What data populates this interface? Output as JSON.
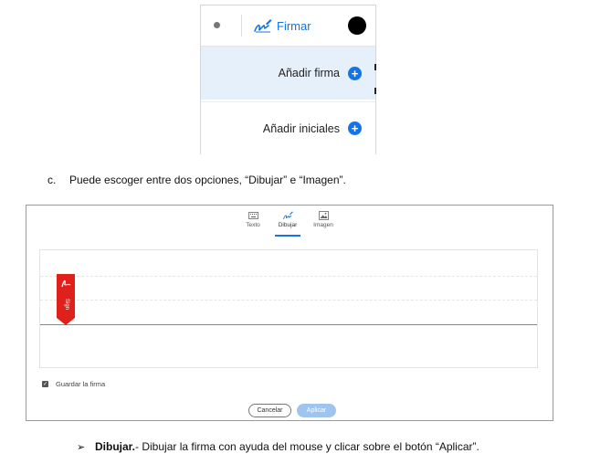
{
  "menu": {
    "firmar_label": "Firmar",
    "items": [
      {
        "label": "Añadir firma",
        "icon": "plus-circle-icon"
      },
      {
        "label": "Añadir iniciales",
        "icon": "plus-circle-icon"
      }
    ],
    "accent": "#1473e6",
    "highlight": "#e6f0fa"
  },
  "paragraph_c": {
    "marker": "c.",
    "text": "Puede escoger entre dos opciones, “Dibujar” e “Imagen”."
  },
  "dialog": {
    "tabs": [
      {
        "label": "Texto",
        "icon": "keyboard-icon"
      },
      {
        "label": "Dibujar",
        "icon": "pen-icon",
        "active": true
      },
      {
        "label": "Imagen",
        "icon": "image-icon"
      }
    ],
    "tag_text": "Sign",
    "save_label": "Guardar la firma",
    "save_checked": true,
    "cancel_label": "Cancelar",
    "apply_label": "Aplicar"
  },
  "bullet": {
    "marker": "➢",
    "bold": "Dibujar.",
    "text": "- Dibujar la firma con ayuda del mouse y clicar sobre el botón “Aplicar”."
  }
}
